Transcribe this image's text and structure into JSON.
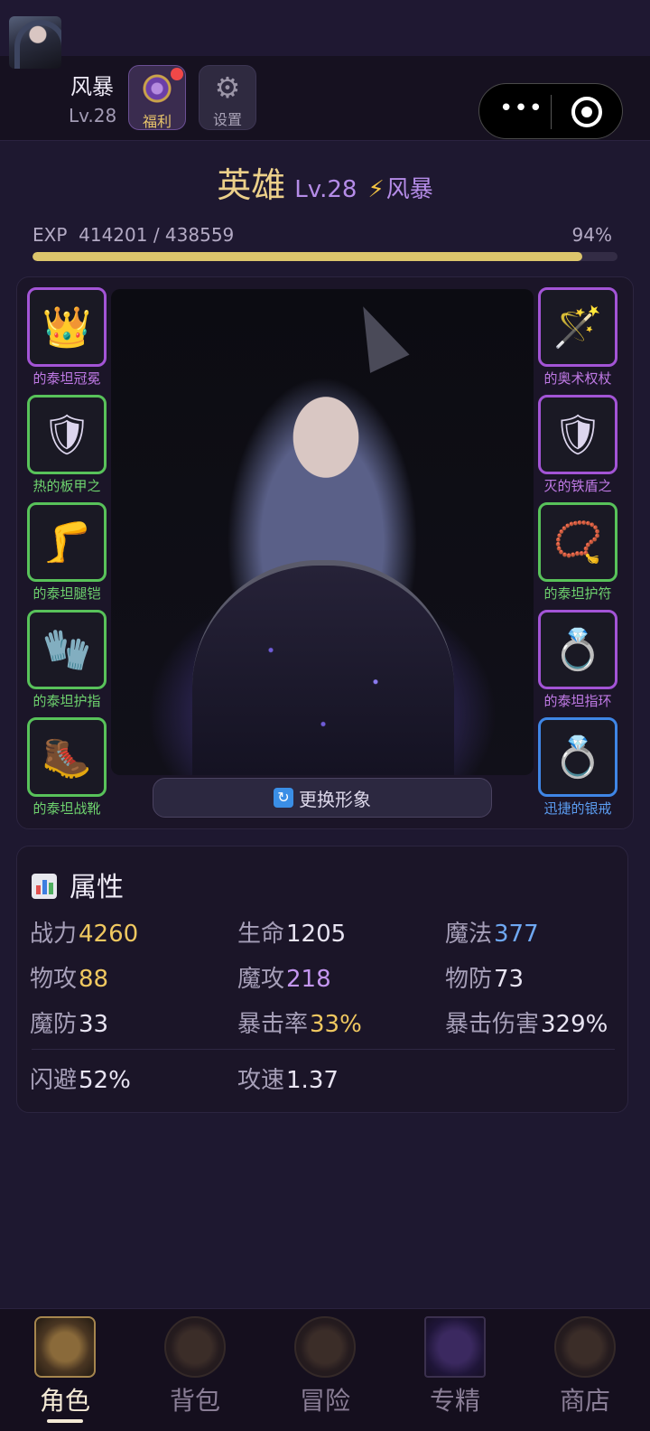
{
  "player": {
    "name": "风暴",
    "level": "Lv.28"
  },
  "header_buttons": {
    "welfare": {
      "label": "福利",
      "icon": "welfare-badge-icon",
      "has_notification": true
    },
    "settings": {
      "label": "设置",
      "icon": "gear-icon"
    }
  },
  "capsule": {
    "more_icon": "more-dots-icon",
    "close_icon": "target-icon"
  },
  "hero": {
    "title": "英雄",
    "level": "Lv.28",
    "class_icon": "lightning-icon",
    "class_name": "风暴"
  },
  "exp": {
    "label": "EXP  414201 / 438559",
    "percent_text": "94%",
    "progress_fraction": 0.94
  },
  "equipment": {
    "left": [
      {
        "name": "的泰坦冠冕",
        "icon": "crown-icon",
        "glyph": "👑",
        "rarity": "purple"
      },
      {
        "name": "热的板甲之",
        "icon": "shield-icon",
        "glyph": "🛡",
        "rarity": "green"
      },
      {
        "name": "的泰坦腿铠",
        "icon": "leg-armor-icon",
        "glyph": "🦵",
        "rarity": "green"
      },
      {
        "name": "的泰坦护指",
        "icon": "gloves-icon",
        "glyph": "🧤",
        "rarity": "green"
      },
      {
        "name": "的泰坦战靴",
        "icon": "boots-icon",
        "glyph": "🥾",
        "rarity": "green"
      }
    ],
    "right": [
      {
        "name": "的奥术权杖",
        "icon": "magic-wand-icon",
        "glyph": "🪄",
        "rarity": "purple"
      },
      {
        "name": "灭的铁盾之",
        "icon": "shield-icon",
        "glyph": "🛡",
        "rarity": "purple"
      },
      {
        "name": "的泰坦护符",
        "icon": "prayer-beads-icon",
        "glyph": "📿",
        "rarity": "green"
      },
      {
        "name": "的泰坦指环",
        "icon": "ring-icon",
        "glyph": "💍",
        "rarity": "purple"
      },
      {
        "name": "迅捷的银戒",
        "icon": "ring-icon",
        "glyph": "💍",
        "rarity": "blue"
      }
    ]
  },
  "change_appearance": {
    "label": "更换形象",
    "icon": "refresh-icon"
  },
  "attributes": {
    "title": "属性",
    "title_icon": "bar-chart-icon",
    "stats": [
      {
        "name": "战力",
        "value": "4260"
      },
      {
        "name": "生命",
        "value": "1205"
      },
      {
        "name": "魔法",
        "value": "377"
      },
      {
        "name": "物攻",
        "value": "88"
      },
      {
        "name": "魔攻",
        "value": "218"
      },
      {
        "name": "物防",
        "value": "73"
      },
      {
        "name": "魔防",
        "value": "33"
      },
      {
        "name": "暴击率",
        "value": "33%"
      },
      {
        "name": "暴击伤害",
        "value": "329%"
      },
      {
        "name": "闪避",
        "value": "52%"
      },
      {
        "name": "攻速",
        "value": "1.37"
      }
    ]
  },
  "tabs": [
    {
      "label": "角色",
      "icon": "character-tab-icon",
      "active": true
    },
    {
      "label": "背包",
      "icon": "backpack-tab-icon",
      "active": false
    },
    {
      "label": "冒险",
      "icon": "adventure-tab-icon",
      "active": false
    },
    {
      "label": "专精",
      "icon": "mastery-tab-icon",
      "active": false
    },
    {
      "label": "商店",
      "icon": "shop-tab-icon",
      "active": false
    }
  ],
  "colors": {
    "background": "#1e1830",
    "gold": "#ecd08a",
    "purple_accent": "#b58ce8",
    "rarity_green": "#58c25a",
    "rarity_purple": "#a354d6",
    "rarity_blue": "#3f86e6"
  }
}
